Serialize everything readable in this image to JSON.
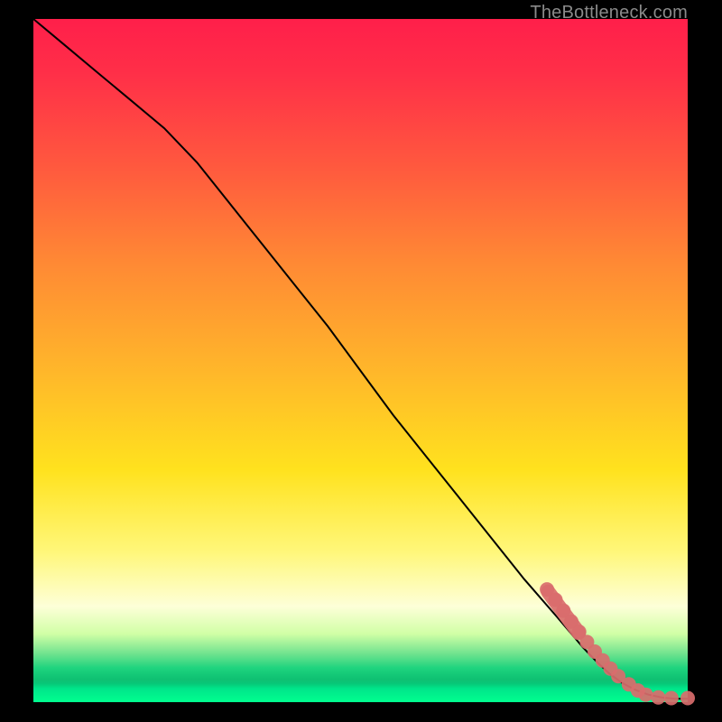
{
  "watermark": "TheBottleneck.com",
  "colors": {
    "marker": "#d96d6d",
    "curve": "#000000"
  },
  "chart_data": {
    "type": "line",
    "title": "",
    "xlabel": "",
    "ylabel": "",
    "xlim": [
      0,
      100
    ],
    "ylim": [
      0,
      100
    ],
    "series": [
      {
        "name": "curve",
        "x": [
          0,
          5,
          10,
          15,
          20,
          25,
          30,
          35,
          40,
          45,
          50,
          55,
          60,
          65,
          70,
          75,
          80,
          84,
          86,
          88,
          90,
          92,
          94,
          96,
          98,
          100
        ],
        "y": [
          100,
          96,
          92,
          88,
          84,
          79,
          73,
          67,
          61,
          55,
          48.5,
          42,
          36,
          30,
          24,
          18,
          12.5,
          8,
          6,
          4.2,
          2.8,
          1.8,
          1.1,
          0.7,
          0.5,
          0.5
        ]
      }
    ],
    "markers": [
      {
        "x": 78.5,
        "y": 16.5
      },
      {
        "x": 79.8,
        "y": 15.0
      },
      {
        "x": 81.0,
        "y": 13.4
      },
      {
        "x": 82.2,
        "y": 11.8
      },
      {
        "x": 83.4,
        "y": 10.3
      },
      {
        "x": 84.6,
        "y": 8.8
      },
      {
        "x": 85.8,
        "y": 7.4
      },
      {
        "x": 87.0,
        "y": 6.1
      },
      {
        "x": 88.2,
        "y": 4.9
      },
      {
        "x": 89.4,
        "y": 3.8
      },
      {
        "x": 91.0,
        "y": 2.6
      },
      {
        "x": 92.4,
        "y": 1.7
      },
      {
        "x": 93.6,
        "y": 1.1
      },
      {
        "x": 95.5,
        "y": 0.7
      },
      {
        "x": 97.5,
        "y": 0.6
      },
      {
        "x": 100.0,
        "y": 0.6
      }
    ],
    "marker_radius_pct": 1.1,
    "elongated_cluster": {
      "comment": "continuous salmon blob along upper marker group",
      "x0": 78.0,
      "y0": 17.0,
      "x1": 84.0,
      "y1": 9.3,
      "width_pct": 2.2
    }
  }
}
